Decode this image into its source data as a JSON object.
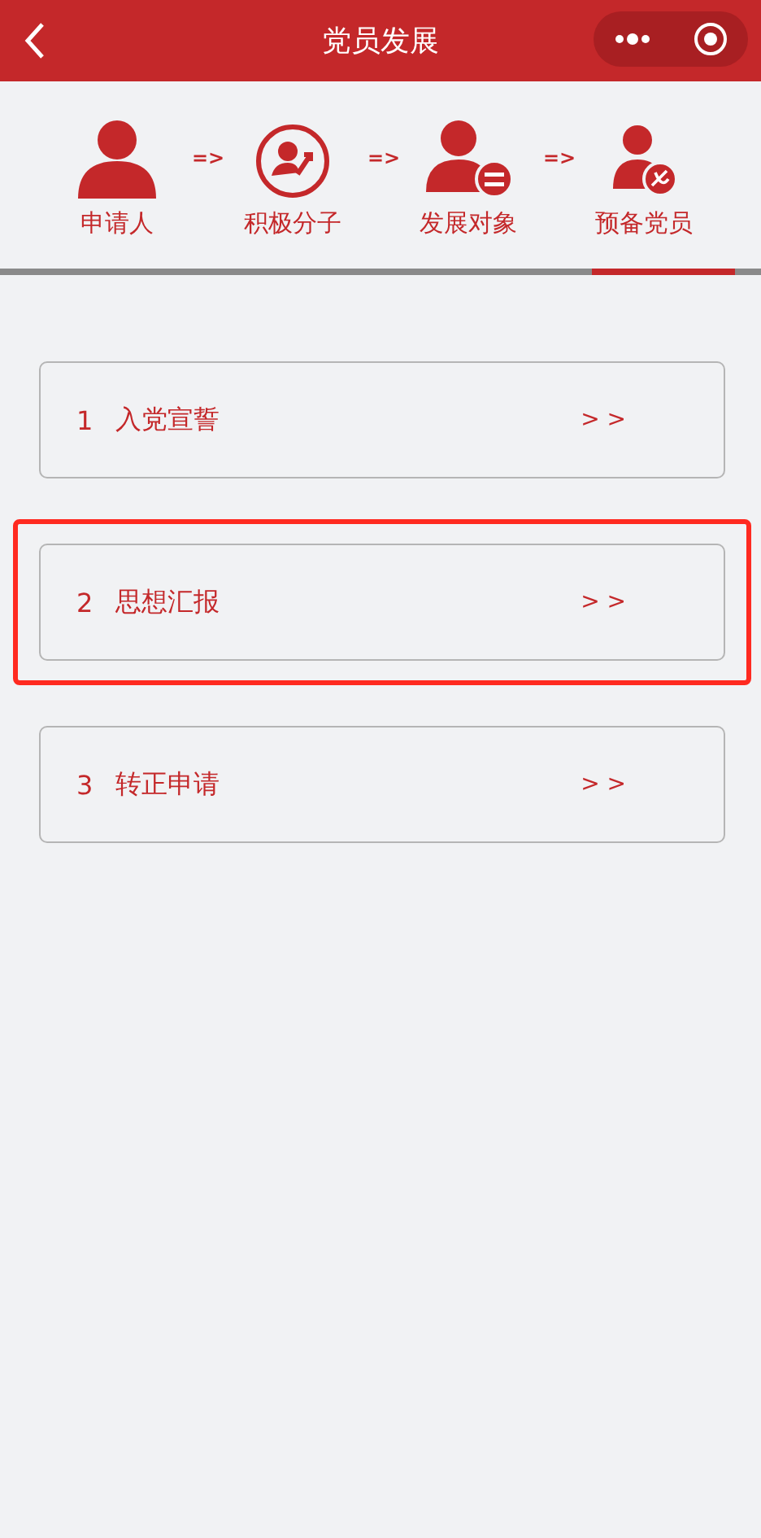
{
  "header": {
    "title": "党员发展"
  },
  "steps": [
    {
      "label": "申请人",
      "selected": false
    },
    {
      "label": "积极分子",
      "selected": false
    },
    {
      "label": "发展对象",
      "selected": false
    },
    {
      "label": "预备党员",
      "selected": true
    }
  ],
  "step_arrows": [
    "=>",
    "=>",
    "=>"
  ],
  "items": [
    {
      "number": "1",
      "label": "入党宣誓",
      "arrow": "> >",
      "highlighted": false
    },
    {
      "number": "2",
      "label": "思想汇报",
      "arrow": "> >",
      "highlighted": true
    },
    {
      "number": "3",
      "label": "转正申请",
      "arrow": "> >",
      "highlighted": false
    }
  ]
}
